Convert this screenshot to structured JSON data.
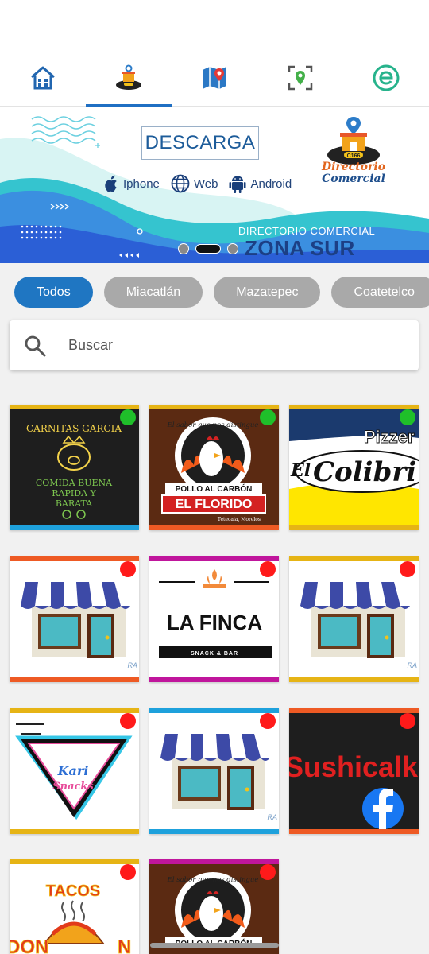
{
  "nav": {
    "items": [
      {
        "name": "home-icon",
        "active": false
      },
      {
        "name": "c166-logo-icon",
        "active": true
      },
      {
        "name": "map-icon",
        "active": false
      },
      {
        "name": "location-scan-icon",
        "active": false
      },
      {
        "name": "e-logo-icon",
        "active": false
      }
    ]
  },
  "banner": {
    "descarga": "DESCARGA",
    "platforms": [
      {
        "label": "Iphone",
        "icon": "apple-icon"
      },
      {
        "label": "Web",
        "icon": "globe-icon"
      },
      {
        "label": "Android",
        "icon": "android-icon"
      }
    ],
    "brand_badge": "C166",
    "brand_line1": "Directorio",
    "brand_line2": "Comercial",
    "subtitle": "DIRECTORIO COMERCIAL",
    "title": "ZONA SUR",
    "active_slide": 2,
    "slides": 3
  },
  "filters": [
    "Todos",
    "Miacatlán",
    "Mazatepec",
    "Coatetelco"
  ],
  "search": {
    "placeholder": "Buscar"
  },
  "colors": {
    "accent": "#1f76c2",
    "open": "#1fbf2a",
    "closed": "#ff1a1a",
    "yellow": "#e6b415",
    "orange": "#ee5a24",
    "magenta": "#c0169c",
    "blue": "#1ea1dc"
  },
  "cards": [
    {
      "kind": "carnitas",
      "status": "open",
      "top": "#e6b415",
      "bottom": "#1ea1dc",
      "line1": "CARNITAS GARCIA",
      "line2": "COMIDA BUENA",
      "line3": "RAPIDA Y",
      "line4": "BARATA"
    },
    {
      "kind": "pollo",
      "status": "open",
      "top": "#e6b415",
      "bottom": "#ee5a24",
      "slogan": "El sabor que nos distingue",
      "line1": "POLLO AL CARBÓN",
      "line2": "EL FLORIDO",
      "line3": "Tetecala, Morelos"
    },
    {
      "kind": "pizza",
      "status": "open",
      "top": "#e6b415",
      "bottom": "#e6b415",
      "line1": "Pizzer",
      "line2": "El",
      "line3": "Colibri"
    },
    {
      "kind": "store",
      "status": "closed",
      "top": "#ee5a24",
      "bottom": "#ee5a24",
      "tag": "RA"
    },
    {
      "kind": "finca",
      "status": "closed",
      "top": "#c0169c",
      "bottom": "#c0169c",
      "line1": "LA FINCA",
      "line2": "SNACK & BAR"
    },
    {
      "kind": "store",
      "status": "closed",
      "top": "#e6b415",
      "bottom": "#e6b415",
      "tag": "RA"
    },
    {
      "kind": "kari",
      "status": "closed",
      "top": "#e6b415",
      "bottom": "#e6b415",
      "line1": "Kari",
      "line2": "Snacks"
    },
    {
      "kind": "store",
      "status": "closed",
      "top": "#1ea1dc",
      "bottom": "#1ea1dc",
      "tag": "RA"
    },
    {
      "kind": "sushi",
      "status": "closed",
      "top": "#ee5a24",
      "bottom": "#ee5a24",
      "line1": "Sushicalk"
    },
    {
      "kind": "tacos",
      "status": "closed",
      "top": "#e6b415",
      "bottom": "#e6b415",
      "line1": "TACOS",
      "line2": "DON",
      "line3": "N"
    },
    {
      "kind": "pollo2",
      "status": "closed",
      "top": "#c0169c",
      "bottom": "#c0169c",
      "slogan": "El sabor que nos distingue",
      "line1": "POLLO AL CARBÓN"
    }
  ]
}
